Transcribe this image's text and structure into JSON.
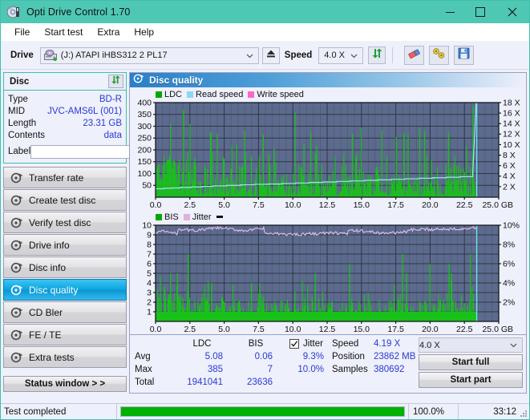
{
  "window": {
    "title": "Opti Drive Control 1.70",
    "icon": "disc-icon",
    "minimize": "minimize-icon",
    "maximize": "maximize-icon",
    "close": "close-icon",
    "titlebar_color": "#4ec8b4"
  },
  "menu": {
    "items": [
      {
        "label": "File"
      },
      {
        "label": "Start test"
      },
      {
        "label": "Extra"
      },
      {
        "label": "Help"
      }
    ]
  },
  "toolbar": {
    "drive_label": "Drive",
    "drive_value": "(J:)  ATAPI iHBS312  2 PL17",
    "eject": "eject-icon",
    "speed_label": "Speed",
    "speed_value": "4.0 X",
    "refresh": "refresh-icon",
    "erase": "eraser-icon",
    "settings": "wrench-icon",
    "save": "save-icon"
  },
  "disc_panel": {
    "title": "Disc",
    "refresh_button": "refresh-icon",
    "rows": [
      {
        "key": "Type",
        "value": "BD-R"
      },
      {
        "key": "MID",
        "value": "JVC-AMS6L (001)"
      },
      {
        "key": "Length",
        "value": "23.31 GB"
      },
      {
        "key": "Contents",
        "value": "data"
      }
    ],
    "label_key": "Label",
    "label_value": "",
    "label_placeholder": "",
    "label_button": "disc-label-icon"
  },
  "sidebar": {
    "items": [
      {
        "label": "Transfer rate",
        "icon": "disc-test-icon",
        "active": false
      },
      {
        "label": "Create test disc",
        "icon": "disc-test-icon",
        "active": false
      },
      {
        "label": "Verify test disc",
        "icon": "disc-test-icon",
        "active": false
      },
      {
        "label": "Drive info",
        "icon": "disc-test-icon",
        "active": false
      },
      {
        "label": "Disc info",
        "icon": "disc-test-icon",
        "active": false
      },
      {
        "label": "Disc quality",
        "icon": "disc-test-icon",
        "active": true
      },
      {
        "label": "CD Bler",
        "icon": "disc-test-icon",
        "active": false
      },
      {
        "label": "FE / TE",
        "icon": "disc-test-icon",
        "active": false
      },
      {
        "label": "Extra tests",
        "icon": "disc-test-icon",
        "active": false
      }
    ],
    "status_window_button": "Status window > >"
  },
  "content": {
    "header_title": "Disc quality",
    "header_icon": "disc-quality-icon"
  },
  "chart_data": [
    {
      "type": "line",
      "name": "ldc-chart",
      "title": "",
      "xlabel": "GB",
      "ylabel": "",
      "xlim": [
        0,
        25
      ],
      "xticks": [
        "0.0",
        "2.5",
        "5.0",
        "7.5",
        "10.0",
        "12.5",
        "15.0",
        "17.5",
        "20.0",
        "22.5",
        "25.0 GB"
      ],
      "ylim": [
        0,
        400
      ],
      "yticks": [
        50,
        100,
        150,
        200,
        250,
        300,
        350,
        400
      ],
      "y2lim": [
        0,
        18
      ],
      "y2ticks": [
        "2 X",
        "4 X",
        "6 X",
        "8 X",
        "10 X",
        "12 X",
        "14 X",
        "16 X",
        "18 X"
      ],
      "grid": true,
      "plot_bg": "#5c6b8d",
      "legend_position": "top-left",
      "legend": [
        {
          "name": "LDC",
          "color": "#00a800"
        },
        {
          "name": "Read speed",
          "color": "#87d9f5"
        },
        {
          "name": "Write speed",
          "color": "#ff66cc"
        }
      ],
      "series": [
        {
          "name": "LDC",
          "color": "#16c116",
          "avg": 5.08,
          "max": 385,
          "total": 1941041
        },
        {
          "name": "Read speed",
          "color": "#9fe3f8",
          "x": [
            0.0,
            0.6,
            1.2,
            1.8,
            2.6,
            3.4,
            4.2,
            5.2,
            6.2,
            7.2,
            8.2,
            9.2,
            10.2,
            11.2,
            12.2,
            13.2,
            14.2,
            15.2,
            16.2,
            17.2,
            18.2,
            19.2,
            20.2,
            21.2,
            22.2,
            23.1,
            23.35
          ],
          "y": [
            1.6,
            1.7,
            1.75,
            1.85,
            1.95,
            2.05,
            2.15,
            2.25,
            2.35,
            2.45,
            2.5,
            2.6,
            2.7,
            2.8,
            2.9,
            3.0,
            3.1,
            3.2,
            3.3,
            3.4,
            3.5,
            3.6,
            3.7,
            3.8,
            3.9,
            4.0,
            18.0
          ]
        }
      ]
    },
    {
      "type": "line",
      "name": "bis-jitter-chart",
      "title": "",
      "xlabel": "GB",
      "ylabel": "",
      "xlim": [
        0,
        25
      ],
      "xticks": [
        "0.0",
        "2.5",
        "5.0",
        "7.5",
        "10.0",
        "12.5",
        "15.0",
        "17.5",
        "20.0",
        "22.5",
        "25.0 GB"
      ],
      "ylim": [
        0,
        10
      ],
      "yticks": [
        1,
        2,
        3,
        4,
        5,
        6,
        7,
        8,
        9,
        10
      ],
      "y2lim": [
        0,
        10
      ],
      "y2ticks": [
        "2%",
        "4%",
        "6%",
        "8%",
        "10%"
      ],
      "grid": true,
      "plot_bg": "#5c6b8d",
      "legend_position": "top-left",
      "legend": [
        {
          "name": "BIS",
          "color": "#00a800"
        },
        {
          "name": "Jitter",
          "color": "#e0b0d8"
        }
      ],
      "series": [
        {
          "name": "BIS",
          "color": "#16c116",
          "avg": 0.06,
          "max": 7,
          "total": 23636
        },
        {
          "name": "Jitter",
          "color": "#eabfe2",
          "avg_pct": "9.3%",
          "max_pct": "10.0%"
        }
      ]
    }
  ],
  "stats": {
    "columns": [
      "LDC",
      "BIS"
    ],
    "jitter_label": "Jitter",
    "jitter_checked": true,
    "rows": [
      {
        "label": "Avg",
        "ldc": "5.08",
        "bis": "0.06",
        "jitter": "9.3%"
      },
      {
        "label": "Max",
        "ldc": "385",
        "bis": "7",
        "jitter": "10.0%"
      },
      {
        "label": "Total",
        "ldc": "1941041",
        "bis": "23636",
        "jitter": ""
      }
    ],
    "speed_label": "Speed",
    "speed_value": "4.19 X",
    "position_label": "Position",
    "position_value": "23862 MB",
    "samples_label": "Samples",
    "samples_value": "380692",
    "speed_select": "4.0 X",
    "start_full": "Start full",
    "start_part": "Start part"
  },
  "statusbar": {
    "message": "Test completed",
    "progress_pct": "100.0%",
    "progress_value": 100,
    "elapsed": "33:12",
    "progress_color": "#00b200"
  }
}
